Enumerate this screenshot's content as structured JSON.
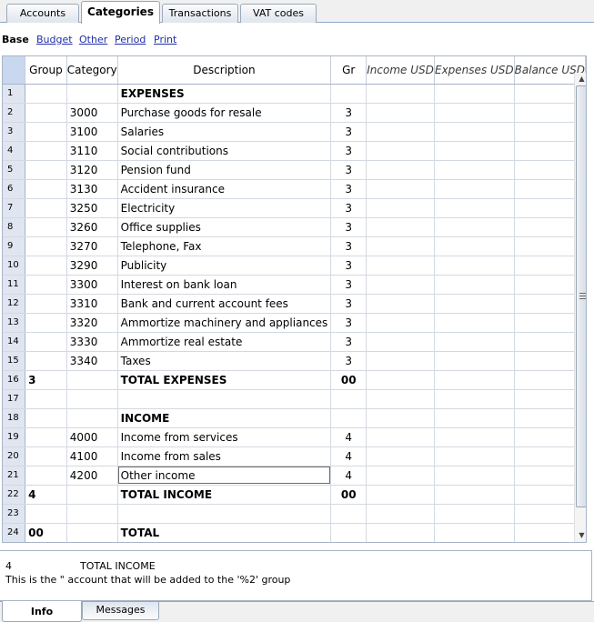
{
  "tabs": [
    "Accounts",
    "Categories",
    "Transactions",
    "VAT codes"
  ],
  "views": {
    "base": "Base",
    "links": [
      "Budget",
      "Other",
      "Period",
      "Print"
    ]
  },
  "columns": [
    "Group",
    "Category",
    "Description",
    "Gr",
    "Income USD",
    "Expenses USD",
    "Balance USD"
  ],
  "rows": [
    {
      "n": "1",
      "group": "",
      "category": "",
      "description": "EXPENSES",
      "gr": ""
    },
    {
      "n": "2",
      "group": "",
      "category": "3000",
      "description": "Purchase goods for resale",
      "gr": "3"
    },
    {
      "n": "3",
      "group": "",
      "category": "3100",
      "description": "Salaries",
      "gr": "3"
    },
    {
      "n": "4",
      "group": "",
      "category": "3110",
      "description": "Social contributions",
      "gr": "3"
    },
    {
      "n": "5",
      "group": "",
      "category": "3120",
      "description": "Pension fund",
      "gr": "3"
    },
    {
      "n": "6",
      "group": "",
      "category": "3130",
      "description": "Accident insurance",
      "gr": "3"
    },
    {
      "n": "7",
      "group": "",
      "category": "3250",
      "description": "Electricity",
      "gr": "3"
    },
    {
      "n": "8",
      "group": "",
      "category": "3260",
      "description": "Office supplies",
      "gr": "3"
    },
    {
      "n": "9",
      "group": "",
      "category": "3270",
      "description": "Telephone, Fax",
      "gr": "3"
    },
    {
      "n": "10",
      "group": "",
      "category": "3290",
      "description": "Publicity",
      "gr": "3"
    },
    {
      "n": "11",
      "group": "",
      "category": "3300",
      "description": "Interest on bank loan",
      "gr": "3"
    },
    {
      "n": "12",
      "group": "",
      "category": "3310",
      "description": "Bank and current account fees",
      "gr": "3"
    },
    {
      "n": "13",
      "group": "",
      "category": "3320",
      "description": "Ammortize machinery and appliances",
      "gr": "3"
    },
    {
      "n": "14",
      "group": "",
      "category": "3330",
      "description": "Ammortize real estate",
      "gr": "3"
    },
    {
      "n": "15",
      "group": "",
      "category": "3340",
      "description": "Taxes",
      "gr": "3"
    },
    {
      "n": "16",
      "group": "3",
      "category": "",
      "description": "TOTAL EXPENSES",
      "gr": "00"
    },
    {
      "n": "17",
      "group": "",
      "category": "",
      "description": "",
      "gr": ""
    },
    {
      "n": "18",
      "group": "",
      "category": "",
      "description": "INCOME",
      "gr": ""
    },
    {
      "n": "19",
      "group": "",
      "category": "4000",
      "description": "Income from services",
      "gr": "4"
    },
    {
      "n": "20",
      "group": "",
      "category": "4100",
      "description": "Income from sales",
      "gr": "4"
    },
    {
      "n": "21",
      "group": "",
      "category": "4200",
      "description": "Other income",
      "gr": "4"
    },
    {
      "n": "22",
      "group": "4",
      "category": "",
      "description": "TOTAL INCOME",
      "gr": "00"
    },
    {
      "n": "23",
      "group": "",
      "category": "",
      "description": "",
      "gr": ""
    },
    {
      "n": "24",
      "group": "00",
      "category": "",
      "description": "TOTAL",
      "gr": ""
    }
  ],
  "bold_rows": [
    1,
    16,
    18,
    22,
    24
  ],
  "selected_row": 21,
  "info": {
    "group": "4",
    "description": "TOTAL INCOME",
    "message": "This is the \" account that will be added to the '%2' group"
  },
  "bottom_tabs": [
    "Info",
    "Messages"
  ],
  "colors": {
    "row_number_bg": "#dfe6f1",
    "link": "#1f2fa8",
    "border": "#a7b4c6"
  }
}
